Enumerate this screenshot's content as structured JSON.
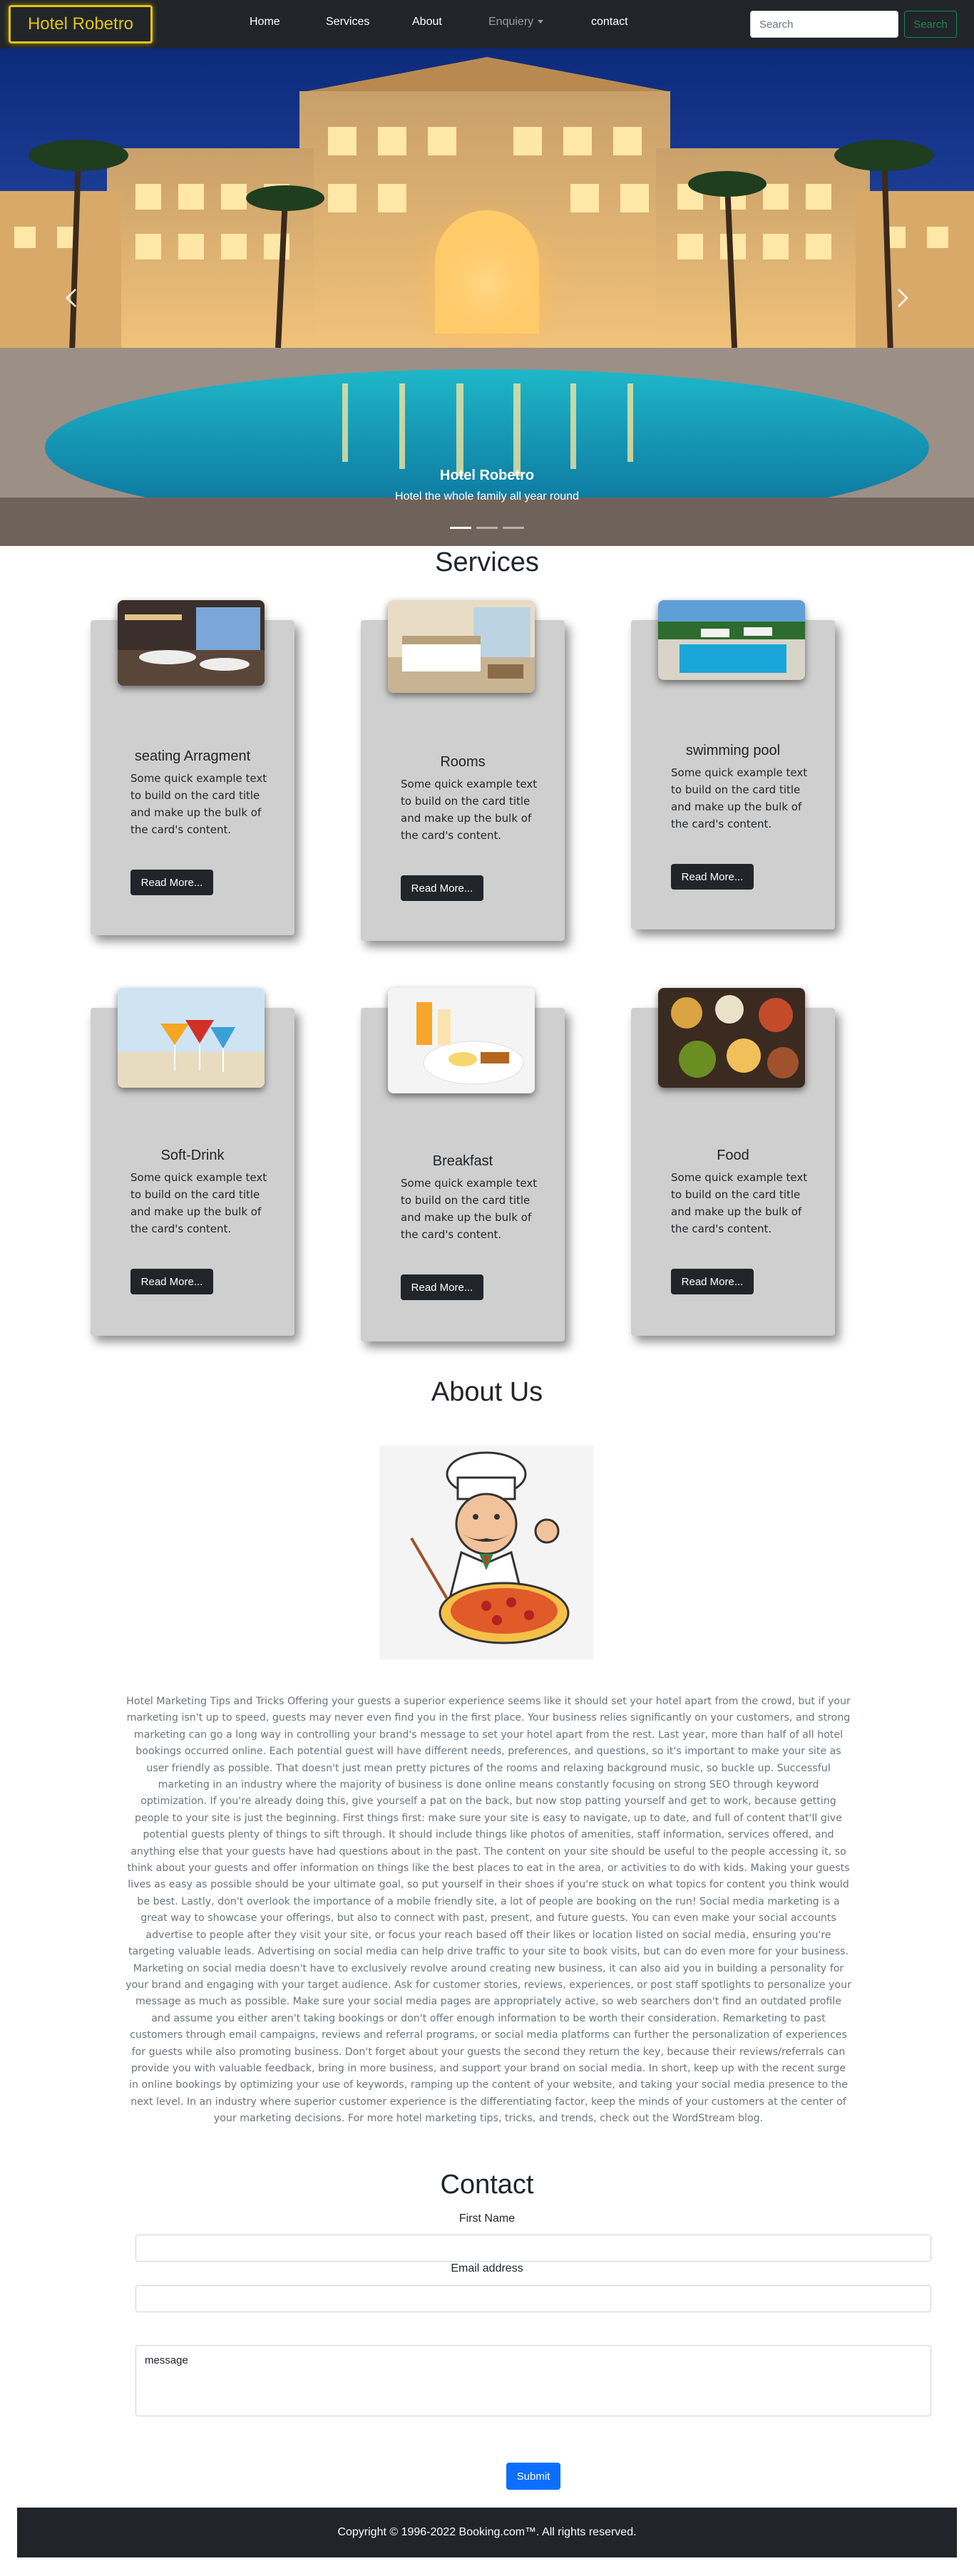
{
  "navbar": {
    "brand": "Hotel Robetro",
    "links": [
      "Home",
      "Services",
      "About",
      "Enquiery",
      "contact"
    ],
    "search_placeholder": "Search",
    "search_button": "Search"
  },
  "hero": {
    "caption_title": "Hotel Robetro",
    "caption_text": "Hotel the whole family all year round",
    "slide_count": 3,
    "active_slide": 1
  },
  "services": {
    "title": "Services",
    "cards": [
      {
        "title": "seating Arragment",
        "text": "Some quick example text to build on the card title and make up the bulk of the card's content.",
        "button": "Read More...",
        "image": "restaurant-seating-image"
      },
      {
        "title": "Rooms",
        "text": "Some quick example text to build on the card title and make up the bulk of the card's content.",
        "button": "Read More...",
        "image": "hotel-room-image"
      },
      {
        "title": "swimming pool",
        "text": "Some quick example text to build on the card title and make up the bulk of the card's content.",
        "button": "Read More...",
        "image": "swimming-pool-image"
      },
      {
        "title": "Soft-Drink",
        "text": "Some quick example text to build on the card title and make up the bulk of the card's content.",
        "button": "Read More...",
        "image": "cocktail-drinks-image"
      },
      {
        "title": "Breakfast",
        "text": "Some quick example text to build on the card title and make up the bulk of the card's content.",
        "button": "Read More...",
        "image": "breakfast-plate-image"
      },
      {
        "title": "Food",
        "text": "Some quick example text to build on the card title and make up the bulk of the card's content.",
        "button": "Read More...",
        "image": "food-platter-image"
      }
    ]
  },
  "about": {
    "title": "About Us",
    "image": "chef-pizza-illustration",
    "text": "Hotel Marketing Tips and Tricks Offering your guests a superior experience seems like it should set your hotel apart from the crowd, but if your marketing isn't up to speed, guests may never even find you in the first place. Your business relies significantly on your customers, and strong marketing can go a long way in controlling your brand's message to set your hotel apart from the rest. Last year, more than half of all hotel bookings occurred online. Each potential guest will have different needs, preferences, and questions, so it's important to make your site as user friendly as possible. That doesn't just mean pretty pictures of the rooms and relaxing background music, so buckle up. Successful marketing in an industry where the majority of business is done online means constantly focusing on strong SEO through keyword optimization. If you're already doing this, give yourself a pat on the back, but now stop patting yourself and get to work, because getting people to your site is just the beginning. First things first: make sure your site is easy to navigate, up to date, and full of content that'll give potential guests plenty of things to sift through. It should include things like photos of amenities, staff information, services offered, and anything else that your guests have had questions about in the past. The content on your site should be useful to the people accessing it, so think about your guests and offer information on things like the best places to eat in the area, or activities to do with kids. Making your guests lives as easy as possible should be your ultimate goal, so put yourself in their shoes if you're stuck on what topics for content you think would be best. Lastly, don't overlook the importance of a mobile friendly site, a lot of people are booking on the run! Social media marketing is a great way to showcase your offerings, but also to connect with past, present, and future guests. You can even make your social accounts advertise to people after they visit your site, or focus your reach based off their likes or location listed on social media, ensuring you're targeting valuable leads. Advertising on social media can help drive traffic to your site to book visits, but can do even more for your business. Marketing on social media doesn't have to exclusively revolve around creating new business, it can also aid you in building a personality for your brand and engaging with your target audience. Ask for customer stories, reviews, experiences, or post staff spotlights to personalize your message as much as possible. Make sure your social media pages are appropriately active, so web searchers don't find an outdated profile and assume you either aren't taking bookings or don't offer enough information to be worth their consideration. Remarketing to past customers through email campaigns, reviews and referral programs, or social media platforms can further the personalization of experiences for guests while also promoting business. Don't forget about your guests the second they return the key, because their reviews/referrals can provide you with valuable feedback, bring in more business, and support your brand on social media. In short, keep up with the recent surge in online bookings by optimizing your use of keywords, ramping up the content of your website, and taking your social media presence to the next level. In an industry where superior customer experience is the differentiating factor, keep the minds of your customers at the center of your marketing decisions. For more hotel marketing tips, tricks, and trends, check out the WordStream blog."
  },
  "contact": {
    "title": "Contact",
    "first_name_label": "First Name",
    "email_label": "Email address",
    "message_placeholder": "message",
    "submit": "Submit"
  },
  "footer": {
    "copyright": "Copyright © 1996-2022 Booking.com™. All rights reserved."
  },
  "colors": {
    "navbar_bg": "#212529",
    "brand_accent": "#e0c419",
    "card_bg": "#cfcfcf",
    "search_button": "#198754",
    "submit_button": "#0d6efd"
  }
}
